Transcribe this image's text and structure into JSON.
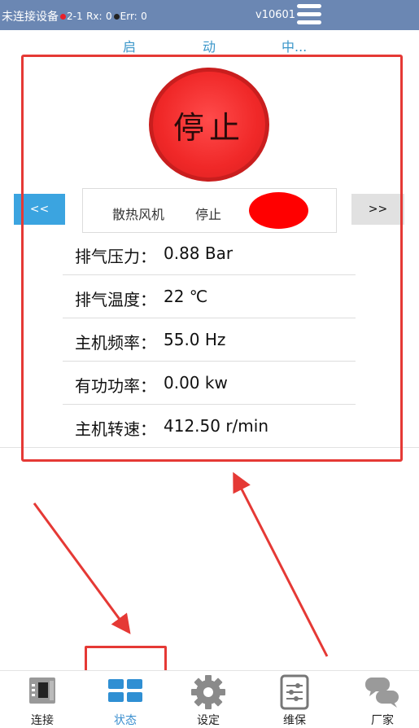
{
  "statusbar": {
    "connection": "未连接设备",
    "port": "2-1",
    "rx_label": "Rx:",
    "rx_value": "0",
    "err_label": "Err:",
    "err_value": "0",
    "version": "v10601"
  },
  "run_state": {
    "chars": [
      "启",
      "动",
      "中..."
    ]
  },
  "stop_button": {
    "label": "停止"
  },
  "navigation": {
    "prev_label": "<<",
    "next_label": ">>"
  },
  "device": {
    "name": "散热风机",
    "state": "停止",
    "indicator_color": "#ff0000"
  },
  "parameters": [
    {
      "label": "排气压力：",
      "value": "0.88 Bar"
    },
    {
      "label": "排气温度：",
      "value": "22 ℃"
    },
    {
      "label": "主机频率：",
      "value": "55.0 Hz"
    },
    {
      "label": "有功功率：",
      "value": "0.00 kw"
    },
    {
      "label": "主机转速：",
      "value": "412.50 r/min"
    }
  ],
  "tabs": [
    {
      "label": "连接",
      "icon": "connect-icon"
    },
    {
      "label": "状态",
      "icon": "status-grid-icon",
      "active": true
    },
    {
      "label": "设定",
      "icon": "gear-icon"
    },
    {
      "label": "维保",
      "icon": "maintenance-icon"
    },
    {
      "label": "厂家",
      "icon": "chat-icon"
    }
  ],
  "colors": {
    "topbar": "#6b87b3",
    "accent": "#3b8fcf",
    "stop_red": "#f02828",
    "annotation_red": "#e53935"
  }
}
